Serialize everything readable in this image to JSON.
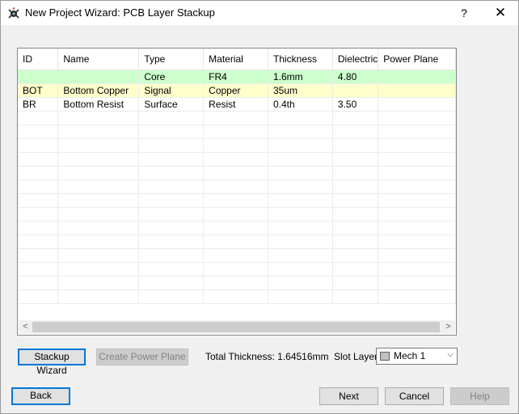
{
  "window": {
    "title": "New Project Wizard: PCB Layer Stackup",
    "help": "?",
    "close": "✕"
  },
  "grid": {
    "columns": [
      "ID",
      "Name",
      "Type",
      "Material",
      "Thickness",
      "Dielectric",
      "Power Plane"
    ],
    "rows": [
      [
        "",
        "",
        "Core",
        "FR4",
        "1.6mm",
        "4.80",
        ""
      ],
      [
        "BOT",
        "Bottom Copper",
        "Signal",
        "Copper",
        "35um",
        "",
        ""
      ],
      [
        "BR",
        "Bottom Resist",
        "Surface",
        "Resist",
        "0.4th",
        "3.50",
        ""
      ]
    ],
    "row_colors": [
      "#ccffcc",
      "#ffffcc",
      "#ffffff"
    ],
    "scroll_left": "<",
    "scroll_right": ">"
  },
  "controls": {
    "stackup_wizard": "Stackup Wizard",
    "create_power_plane": "Create Power Plane",
    "total_thickness": "Total Thickness: 1.64516mm",
    "slot_layer_label": "Slot Layer:",
    "slot_layer_value": "Mech 1"
  },
  "footer": {
    "back": "Back",
    "next": "Next",
    "cancel": "Cancel",
    "help": "Help"
  }
}
